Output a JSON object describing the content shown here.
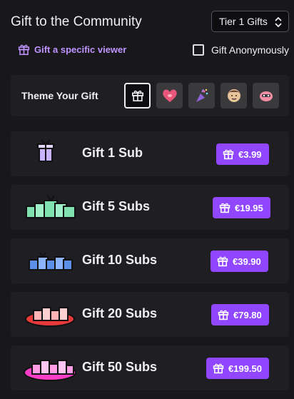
{
  "header": {
    "title": "Gift to the Community",
    "tier_select_value": "Tier 1 Gifts"
  },
  "options": {
    "gift_specific_label": "Gift a specific viewer",
    "anonymous_label": "Gift Anonymously",
    "anonymous_checked": false
  },
  "theme": {
    "label": "Theme Your Gift",
    "options": [
      {
        "icon": "gift-icon",
        "selected": true
      },
      {
        "icon": "heart-emote-icon",
        "selected": false
      },
      {
        "icon": "party-popper-emote-icon",
        "selected": false
      },
      {
        "icon": "face-emote-icon",
        "selected": false
      },
      {
        "icon": "blob-emote-icon",
        "selected": false
      }
    ]
  },
  "tiers": [
    {
      "label": "Gift 1 Sub",
      "price": "€3.99",
      "art_color": "#c7b3ff"
    },
    {
      "label": "Gift 5 Subs",
      "price": "€19.95",
      "art_color": "#7fe0b0"
    },
    {
      "label": "Gift 10 Subs",
      "price": "€39.90",
      "art_color": "#5b8fe8"
    },
    {
      "label": "Gift 20 Subs",
      "price": "€79.80",
      "art_color": "#e83a3a"
    },
    {
      "label": "Gift 50 Subs",
      "price": "€199.50",
      "art_color": "#ff3ec8"
    }
  ],
  "colors": {
    "accent": "#9147ff",
    "link": "#bf94ff",
    "background": "#18181b",
    "card": "#1f1f23"
  }
}
